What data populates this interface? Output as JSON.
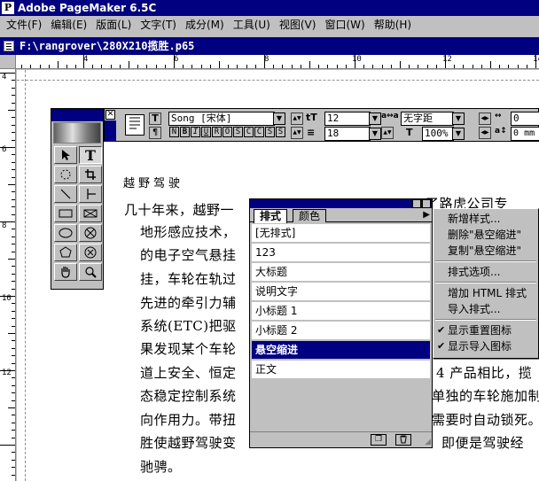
{
  "app": {
    "title": "Adobe PageMaker 6.5C"
  },
  "menu": [
    "文件(F)",
    "编辑(E)",
    "版面(L)",
    "文字(T)",
    "成分(M)",
    "工具(U)",
    "视图(V)",
    "窗口(W)",
    "帮助(H)"
  ],
  "document": {
    "title": "F:\\rangrover\\280X210揽胜.p65",
    "heading": "越野驾驶",
    "lines": [
      "几十年来，越野一",
      "地形感应技术，",
      "的电子空气悬挂",
      "挂，车轮在轨过",
      "先进的牵引力辅",
      "系统(ETC)把驱",
      "果发现某个车轮",
      "道上安全、恒定",
      "态稳定控制系统",
      "向作用力。带扭",
      "胜使越野驾驶变",
      "驰骋。"
    ],
    "line1_tail": "了路虎公司专",
    "right_lines": [
      "4 产品相比，揽",
      "单独的车轮施加制",
      "需要时自动锁死。",
      "即便是驾驶经"
    ]
  },
  "ruler": {
    "h_labels": [
      "4",
      "6",
      "8",
      "10",
      "12",
      "14"
    ],
    "v_labels": [
      "4",
      "6",
      "8",
      "10",
      "12"
    ]
  },
  "control_palette": {
    "font": "Song [宋体]",
    "size": "12",
    "leading": "18",
    "kerning": "无字距",
    "scale": "100%",
    "tracking_val": "0",
    "baseline_val": "0",
    "unit": "mm",
    "style_buttons": [
      "N",
      "B",
      "I",
      "U",
      "R",
      "O",
      "S",
      "C",
      "C",
      "S",
      "S"
    ]
  },
  "styles_palette": {
    "tabs": [
      "排式",
      "颜色"
    ],
    "items": [
      "[无排式]",
      "123",
      "大标题",
      "说明文字",
      "小标题 1",
      "小标题 2",
      "悬空缩进",
      "正文"
    ],
    "selected_index": 6
  },
  "flyout_menu": {
    "items": [
      "新增样式...",
      "删除\"悬空缩进\"",
      "复制\"悬空缩进\"",
      "排式选项...",
      "增加 HTML 排式",
      "导入排式...",
      "显示重置图标",
      "显示导入图标"
    ],
    "checked": [
      "显示重置图标",
      "显示导入图标"
    ]
  },
  "colors": {
    "titlebar": "#000080",
    "face": "#c0c0c0",
    "highlight": "#000080"
  }
}
